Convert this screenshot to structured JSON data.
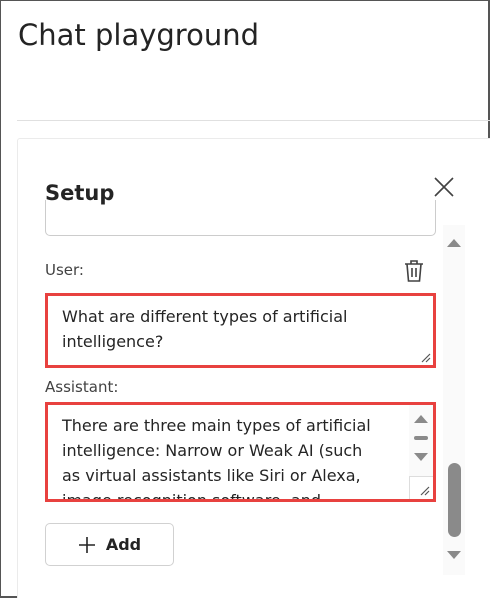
{
  "header": {
    "title": "Chat playground"
  },
  "setup": {
    "title": "Setup",
    "close_icon": "close-icon",
    "messages": [
      {
        "role_label": "User:",
        "text": "What are different types of artificial intelligence?",
        "delete_icon": "trash-icon"
      },
      {
        "role_label": "Assistant:",
        "text": "There are three main types of artificial intelligence: Narrow or Weak AI (such as virtual assistants like Siri or Alexa, image recognition software, and"
      }
    ],
    "add_label": "Add",
    "add_icon": "plus-icon"
  },
  "colors": {
    "highlight": "#e8413f",
    "scrollbar": "#8a8a8a"
  }
}
